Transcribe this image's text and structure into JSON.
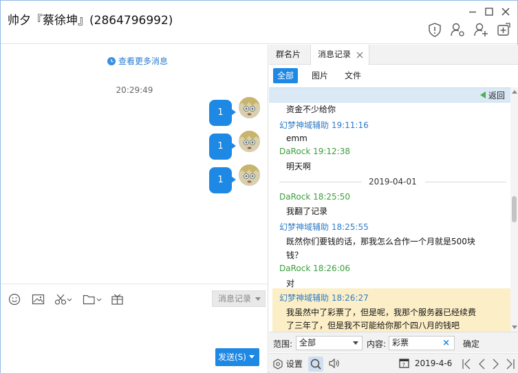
{
  "window": {
    "title": "帅夕『蔡徐坤』(2864796992)",
    "controls": {
      "minimize": "minimize-icon",
      "maximize": "maximize-icon",
      "close": "close-icon"
    },
    "toolbar_icons": [
      "shield-icon",
      "user-settings-icon",
      "add-user-icon",
      "add-app-icon"
    ]
  },
  "chat": {
    "more_messages": "查看更多消息",
    "timestamp": "20:29:49",
    "messages": [
      {
        "text": "1"
      },
      {
        "text": "1"
      },
      {
        "text": "1"
      }
    ],
    "editor_tools": [
      "emoji-icon",
      "image-icon",
      "scissors-icon",
      "folder-icon",
      "gift-icon"
    ],
    "history_button": "消息记录",
    "send_button": "发送(S)"
  },
  "history": {
    "tabs": [
      {
        "label": "群名片"
      },
      {
        "label": "消息记录"
      }
    ],
    "filters": [
      "全部",
      "图片",
      "文件"
    ],
    "back": "返回",
    "date_separator": "2019-04-01",
    "records": [
      {
        "type": "text",
        "text": "资金不少给你"
      },
      {
        "type": "head",
        "sender": "幻梦神域辅助",
        "time": "19:11:16"
      },
      {
        "type": "text",
        "text": "emm"
      },
      {
        "type": "head",
        "sender": "DaRock",
        "time": "19:12:38"
      },
      {
        "type": "text",
        "text": "明天啊"
      },
      {
        "type": "head",
        "sender": "DaRock",
        "time": "18:25:50"
      },
      {
        "type": "text",
        "text": "我翻了记录"
      },
      {
        "type": "head",
        "sender": "幻梦神域辅助",
        "time": "18:25:55"
      },
      {
        "type": "text",
        "text": "既然你们要钱的话，那我怎么合作一个月就是500块"
      },
      {
        "type": "text",
        "text": "钱？"
      },
      {
        "type": "head",
        "sender": "DaRock",
        "time": "18:26:06"
      },
      {
        "type": "text",
        "text": "对"
      },
      {
        "type": "head",
        "sender": "幻梦神域辅助",
        "time": "18:26:27"
      },
      {
        "type": "text",
        "text": "我虽然中了彩票了，但是呢，我那个服务器已经续费"
      },
      {
        "type": "text",
        "text": "了三年了，但是我不可能给你那个四八月的钱吧"
      }
    ],
    "search": {
      "range_label": "范围:",
      "range_value": "全部",
      "content_label": "内容:",
      "content_value": "彩票",
      "ok": "确定"
    },
    "bottom": {
      "settings": "设置",
      "date": "2019-4-6"
    },
    "colors": {
      "green": "#3a9e3a",
      "blue": "#2f7cc9",
      "accent": "#1e88e5",
      "highlight": "#fcefc7"
    }
  }
}
